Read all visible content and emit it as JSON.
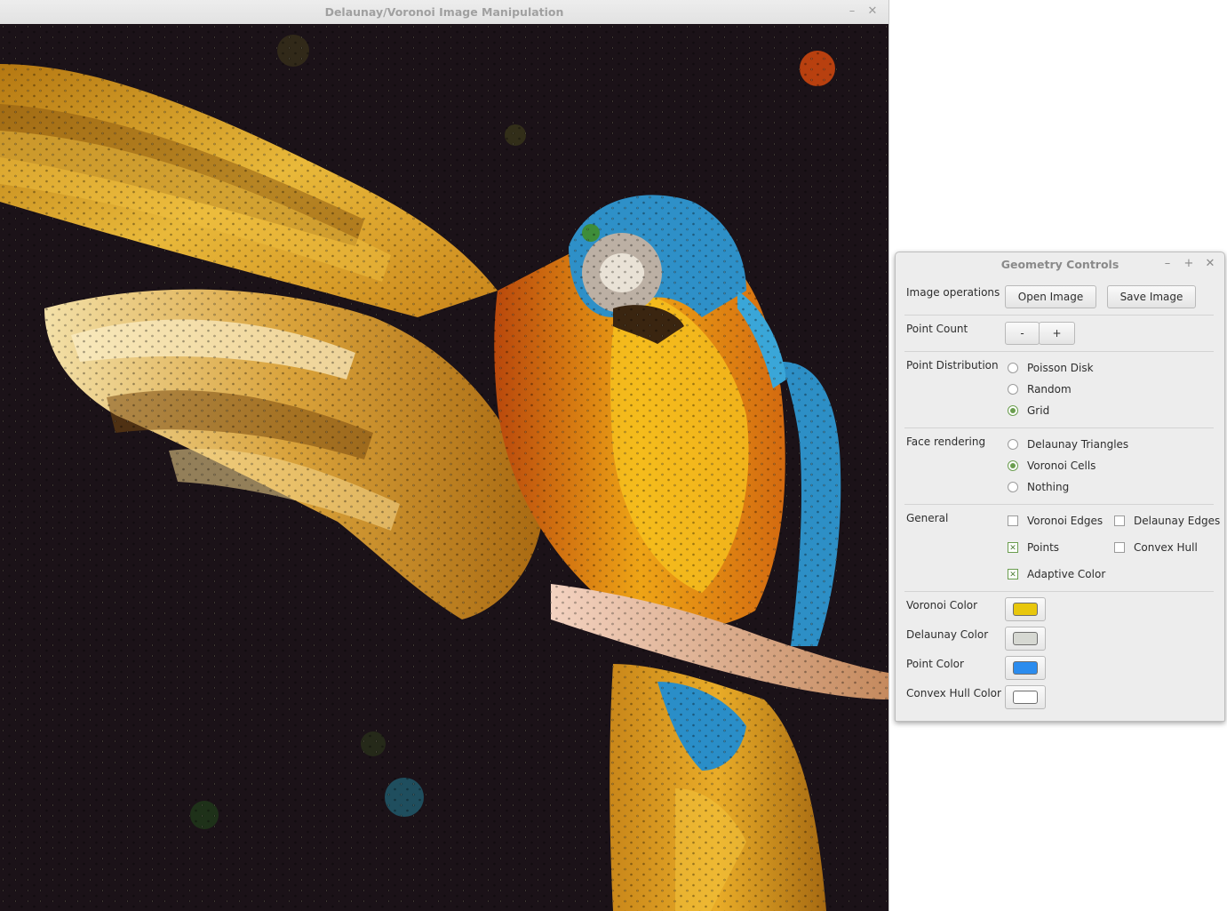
{
  "main_window": {
    "title": "Delaunay/Voronoi Image Manipulation",
    "minimize_icon": "minimize-icon",
    "close_icon": "close-icon"
  },
  "canvas": {
    "background_color": "#1b1218",
    "content": "voronoi-mosaic-image-of-macaw"
  },
  "controls": {
    "title": "Geometry Controls",
    "image_operations": {
      "label": "Image operations",
      "open_label": "Open Image",
      "save_label": "Save Image"
    },
    "point_count": {
      "label": "Point Count",
      "minus_label": "-",
      "plus_label": "+"
    },
    "point_distribution": {
      "label": "Point Distribution",
      "options": [
        "Poisson Disk",
        "Random",
        "Grid"
      ],
      "selected": "Grid"
    },
    "face_rendering": {
      "label": "Face rendering",
      "options": [
        "Delaunay Triangles",
        "Voronoi Cells",
        "Nothing"
      ],
      "selected": "Voronoi Cells"
    },
    "general": {
      "label": "General",
      "voronoi_edges": {
        "label": "Voronoi Edges",
        "checked": false
      },
      "delaunay_edges": {
        "label": "Delaunay Edges",
        "checked": false
      },
      "points": {
        "label": "Points",
        "checked": true
      },
      "convex_hull": {
        "label": "Convex Hull",
        "checked": false
      },
      "adaptive_color": {
        "label": "Adaptive Color",
        "checked": true
      }
    },
    "colors": {
      "voronoi": {
        "label": "Voronoi Color",
        "value": "#e8c70c"
      },
      "delaunay": {
        "label": "Delaunay Color",
        "value": "#d6d8d2"
      },
      "point": {
        "label": "Point Color",
        "value": "#2b8cee"
      },
      "convex_hull": {
        "label": "Convex Hull Color",
        "value": "#ffffff"
      }
    }
  }
}
